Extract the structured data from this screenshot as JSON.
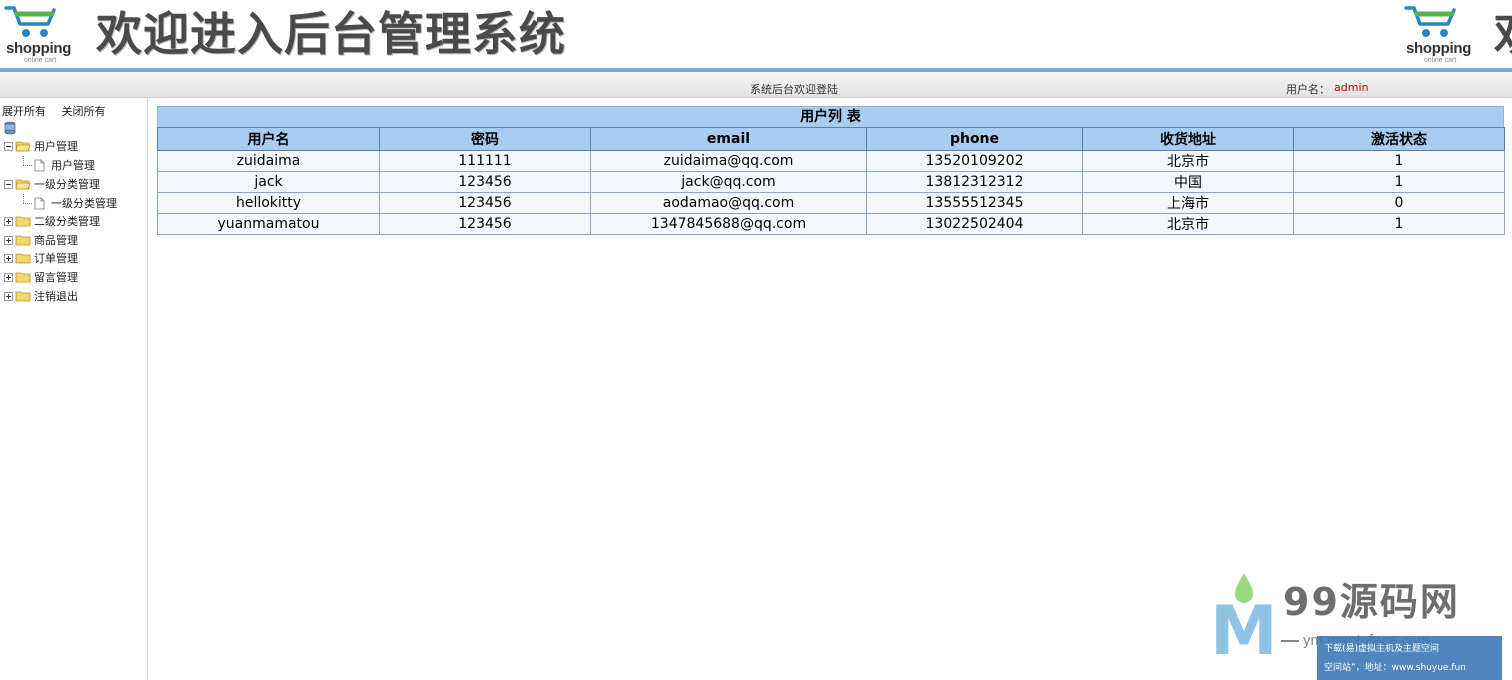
{
  "header": {
    "logo_word": "shopping",
    "logo_sub": "online cart",
    "title": "欢迎进入后台管理系统",
    "title_clip": "欢"
  },
  "statusbar": {
    "welcome": "系统后台欢迎登陆",
    "user_label": "用户名：",
    "user_value": "admin"
  },
  "sidebar": {
    "expand_all": "展开所有",
    "collapse_all": "关闭所有",
    "items": [
      {
        "label": "用户管理",
        "expanded": true,
        "children": [
          "用户管理"
        ]
      },
      {
        "label": "一级分类管理",
        "expanded": true,
        "children": [
          "一级分类管理"
        ]
      },
      {
        "label": "二级分类管理",
        "expanded": false
      },
      {
        "label": "商品管理",
        "expanded": false
      },
      {
        "label": "订单管理",
        "expanded": false
      },
      {
        "label": "留言管理",
        "expanded": false
      },
      {
        "label": "注销退出",
        "expanded": false
      }
    ]
  },
  "user_table": {
    "caption": "用户列 表",
    "columns": [
      "用户名",
      "密码",
      "email",
      "phone",
      "收货地址",
      "激活状态"
    ],
    "rows": [
      [
        "zuidaima",
        "111111",
        "zuidaima@qq.com",
        "13520109202",
        "北京市",
        "1"
      ],
      [
        "jack",
        "123456",
        "jack@qq.com",
        "13812312312",
        "中国",
        "1"
      ],
      [
        "hellokitty",
        "123456",
        "aodamao@qq.com",
        "13555512345",
        "上海市",
        "0"
      ],
      [
        "yuanmamatou",
        "123456",
        "1347845688@qq.com",
        "13022502404",
        "北京市",
        "1"
      ]
    ]
  },
  "watermark": {
    "brand": "99源码网",
    "url": "ym.maptoface.com",
    "corner_line1": "下载(易)虚拟主机及主题空间",
    "corner_line2": "空间站”，地址：www.shuyue.fun"
  },
  "colors": {
    "header_rule": "#7ea6cf",
    "table_header": "#a9cdf0",
    "user_value": "#c00000"
  }
}
